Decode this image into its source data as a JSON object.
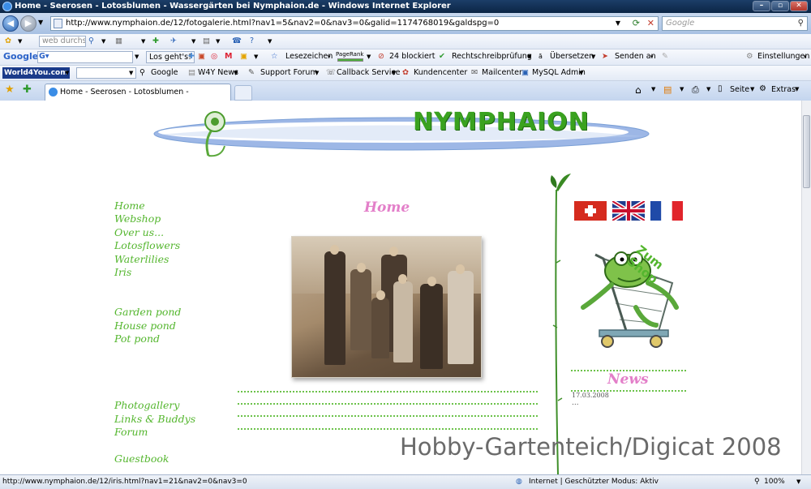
{
  "window": {
    "title": "Home - Seerosen - Lotosblumen - Wassergärten bei Nymphaion.de - Windows Internet Explorer"
  },
  "address": {
    "url": "http://www.nymphaion.de/12/fotogalerie.html?nav1=5&nav2=0&nav3=0&galid=1174768019&galdspg=0"
  },
  "search": {
    "placeholder": "Google"
  },
  "toolbar1": {
    "search_text": "web durchsu"
  },
  "google_bar": {
    "logo": "Google",
    "go_label": "Los geht's!",
    "bookmarks": "Lesezeichen",
    "pagerank": "PageRank",
    "blocked": "24 blockiert",
    "spellcheck": "Rechtschreibprüfung",
    "translate": "Übersetzen",
    "send": "Senden an",
    "settings": "Einstellungen"
  },
  "w4y_bar": {
    "logo": "World4You.com",
    "google": "Google",
    "news": "W4Y News",
    "support": "Support Forum",
    "callback": "Callback Service",
    "customer": "Kundencenter",
    "mail": "Mailcenter",
    "mysql": "MySQL Admin"
  },
  "tab": {
    "label": "Home - Seerosen - Lotosblumen - Wassergärten ..."
  },
  "command_bar": {
    "page": "Seite",
    "extras": "Extras"
  },
  "site": {
    "logo_text": "NYMPHAION",
    "page_heading": "Home",
    "menu_group1": [
      "Home",
      "Webshop",
      "Over us...",
      "Lotosflowers",
      "Waterlilies",
      "Iris"
    ],
    "menu_group2": [
      "Garden pond",
      "House pond",
      "Pot pond"
    ],
    "menu_group3": [
      "Photogallery",
      "Links & Buddys",
      "Forum"
    ],
    "menu_guestbook": "Guestbook",
    "shop_text": "Zum Shop",
    "news_heading": "News",
    "news_date": "17.03.2008",
    "news_more": "...",
    "watermark": "Hobby-Gartenteich/Digicat 2008"
  },
  "status": {
    "url": "http://www.nymphaion.de/12/iris.html?nav1=21&nav2=0&nav3=0",
    "zone": "Internet | Geschützter Modus: Aktiv",
    "zoom": "100%"
  },
  "colors": {
    "menu_green": "#54b62e",
    "heading_pink": "#e37fc9",
    "logo_green": "#3aa21f"
  }
}
